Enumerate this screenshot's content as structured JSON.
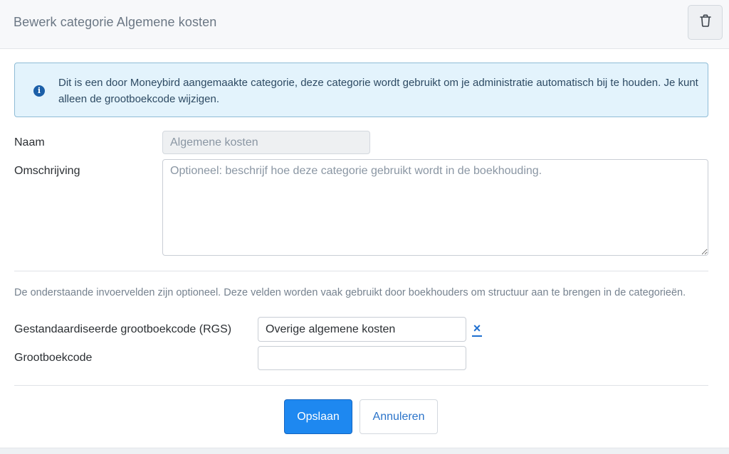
{
  "header": {
    "title": "Bewerk categorie Algemene kosten",
    "delete_icon": "trash-icon"
  },
  "info": {
    "icon": "info-icon",
    "icon_glyph": "i",
    "text": "Dit is een door Moneybird aangemaakte categorie, deze categorie wordt gebruikt om je administratie automatisch bij te houden. Je kunt alleen de grootboekcode wijzigen."
  },
  "form": {
    "name_label": "Naam",
    "name_placeholder": "Algemene kosten",
    "description_label": "Omschrijving",
    "description_placeholder": "Optioneel: beschrijf hoe deze categorie gebruikt wordt in de boekhouding.",
    "hint": "De onderstaande invoervelden zijn optioneel. Deze velden worden vaak gebruikt door boekhouders om structuur aan te brengen in de categorieën.",
    "rgs_label": "Gestandaardiseerde grootboekcode (RGS)",
    "rgs_value": "Overige algemene kosten",
    "rgs_clear_glyph": "×",
    "ledger_label": "Grootboekcode",
    "ledger_value": ""
  },
  "actions": {
    "save_label": "Opslaan",
    "cancel_label": "Annuleren"
  },
  "colors": {
    "primary": "#1e88f0",
    "info_bg": "#e3f3fc",
    "info_border": "#8fbcd6",
    "link": "#1e6fd0"
  }
}
